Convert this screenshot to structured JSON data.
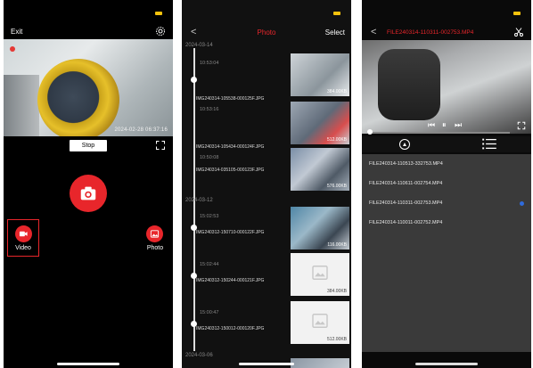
{
  "panel1": {
    "exit_label": "Exit",
    "live_timestamp": "2024-02-28 06:37:16",
    "stop_label": "Stop",
    "video_label": "Video",
    "photo_label": "Photo",
    "icons": [
      "gear-icon",
      "expand-icon",
      "camera-icon",
      "video-camera-icon",
      "photo-icon"
    ],
    "accent_color": "#e8262b",
    "battery_color": "#f4c20d"
  },
  "panel2": {
    "back_label": "<",
    "title": "Photo",
    "select_label": "Select",
    "groups": [
      {
        "date": "2024-03-14",
        "items": [
          {
            "time": "10:53:04",
            "name": "IMG240314-105538-000125F.JPG",
            "size": "384.00KB"
          },
          {
            "time": "10:53:16",
            "name": "IMG240314-105434-000124F.JPG",
            "size": "512.00KB"
          },
          {
            "time": "10:50:08",
            "name": "IMG240314-035105-000123F.JPG",
            "size": "576.00KB"
          }
        ]
      },
      {
        "date": "2024-03-12",
        "items": [
          {
            "time": "15:02:53",
            "name": "IMG240312-150710-000122F.JPG",
            "size": "116.00KB"
          },
          {
            "time": "15:02:44",
            "name": "IMG240312-150244-000121F.JPG",
            "size": "384.00KB"
          },
          {
            "time": "15:00:47",
            "name": "IMG240312-150012-000120F.JPG",
            "size": "512.00KB"
          }
        ]
      },
      {
        "date": "2024-03-06",
        "items": []
      }
    ]
  },
  "panel3": {
    "back_label": "<",
    "title": "FILE240314-110311-002753.MP4",
    "files": [
      "FILE240314-110513-332753.MP4",
      "FILE240314-110611-002754.MP4",
      "FILE240314-110311-002753.MP4",
      "FILE240314-110011-002752.MP4"
    ],
    "selected_index": 2,
    "icons": [
      "scissors-icon",
      "rewind-icon",
      "pause-icon",
      "fast-forward-icon",
      "fullscreen-icon",
      "upload-icon",
      "list-icon"
    ]
  }
}
